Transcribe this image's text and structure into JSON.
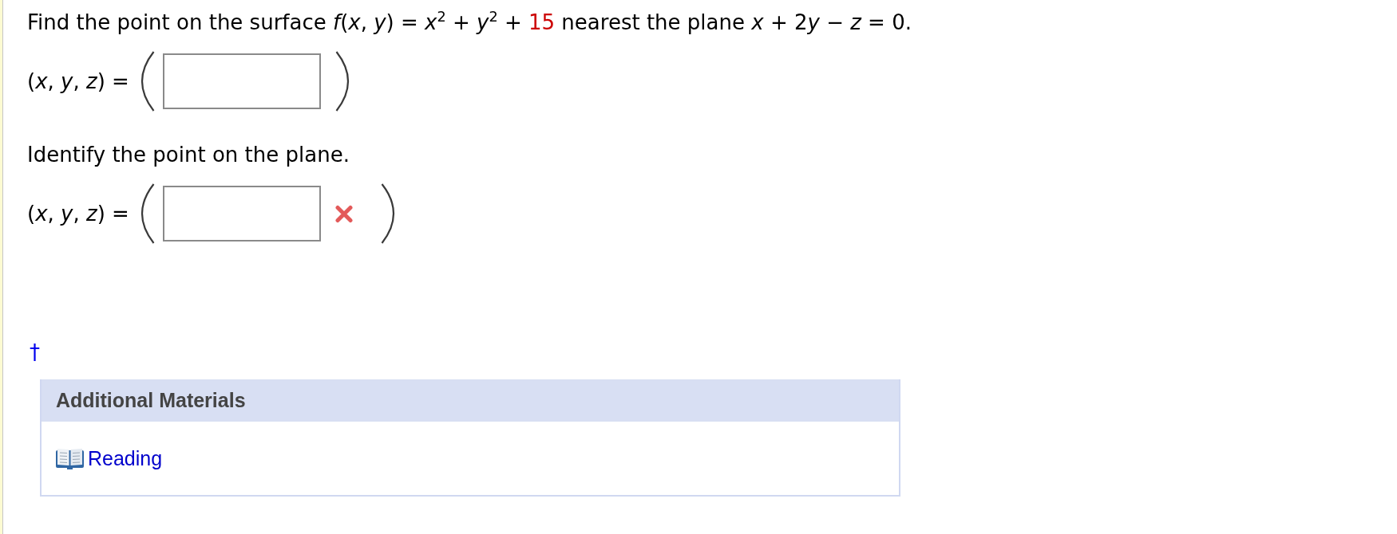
{
  "question": {
    "parts": [
      {
        "kind": "text",
        "text": "Find the point on the surface *f*(*x*, *y*) = *x*$^{2}$ + *y*$^{2}$ + "
      },
      {
        "kind": "given",
        "text": "15"
      },
      {
        "kind": "text",
        "text": " nearest the plane *x* + 2"
      },
      {
        "kind": "text",
        "text": "*y* − *z* = 0."
      }
    ]
  },
  "items": [
    {
      "kind": "answer",
      "label": "(*x*, *y*, *z*) =",
      "incorrect": false
    },
    {
      "kind": "prompt",
      "text": "Identify the point on the plane."
    },
    {
      "kind": "answer",
      "label": "(*x*, *y*, *z*) =",
      "incorrect": true
    }
  ],
  "footnote": {
    "mark": "†"
  },
  "additional_materials": {
    "title": "Additional Materials",
    "links": [
      {
        "label": "Reading"
      }
    ]
  }
}
